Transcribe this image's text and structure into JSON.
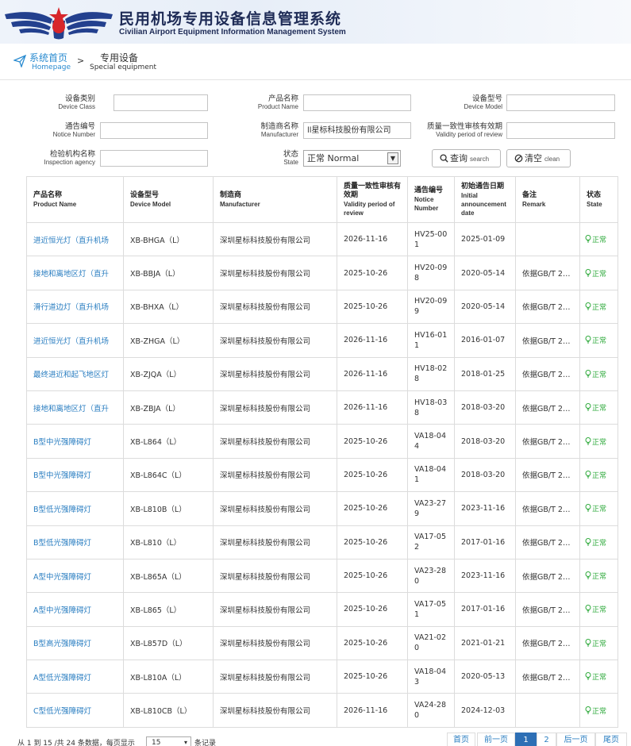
{
  "header": {
    "title_cn": "民用机场专用设备信息管理系统",
    "title_en": "Civilian Airport Equipment Information Management System"
  },
  "breadcrumb": {
    "home_cn": "系统首页",
    "home_en": "Homepage",
    "separator": ">",
    "current_cn": "专用设备",
    "current_en": "Special equipment"
  },
  "filters": {
    "device_class": {
      "label_cn": "设备类别",
      "label_en": "Device Class",
      "value": ""
    },
    "product_name": {
      "label_cn": "产品名称",
      "label_en": "Product Name",
      "value": ""
    },
    "device_model": {
      "label_cn": "设备型号",
      "label_en": "Device Model",
      "value": ""
    },
    "notice_number": {
      "label_cn": "通告编号",
      "label_en": "Notice Number",
      "value": ""
    },
    "manufacturer": {
      "label_cn": "制造商名称",
      "label_en": "Manufacturer",
      "value": "ll星标科技股份有限公司"
    },
    "validity": {
      "label_cn": "质量一致性审核有效期",
      "label_en": "Validity period of review",
      "value": ""
    },
    "inspection": {
      "label_cn": "检验机构名称",
      "label_en": "Inspection agency",
      "value": ""
    },
    "state": {
      "label_cn": "状态",
      "label_en": "State",
      "value": "正常 Normal"
    },
    "search_btn": {
      "cn": "查询",
      "en": "search"
    },
    "clean_btn": {
      "cn": "清空",
      "en": "clean"
    }
  },
  "table": {
    "headers": [
      {
        "cn": "产品名称",
        "en": "Product Name"
      },
      {
        "cn": "设备型号",
        "en": "Device Model"
      },
      {
        "cn": "制造商",
        "en": "Manufacturer"
      },
      {
        "cn": "质量一致性审核有效期",
        "en": "Validity period of review"
      },
      {
        "cn": "通告编号",
        "en": "Notice Number"
      },
      {
        "cn": "初始通告日期",
        "en": "Initial announcement date"
      },
      {
        "cn": "备注",
        "en": "Remark"
      },
      {
        "cn": "状态",
        "en": "State"
      }
    ],
    "rows": [
      {
        "name": "进近恒光灯（直升机场",
        "model": "XB-BHGA（L）",
        "maker": "深圳星标科技股份有限公司",
        "validity": "2026-11-16",
        "notice": "HV25-001",
        "date": "2025-01-09",
        "remark": "",
        "state": "正常"
      },
      {
        "name": "接地和离地区灯（直升",
        "model": "XB-BBJA（L）",
        "maker": "深圳星标科技股份有限公司",
        "validity": "2025-10-26",
        "notice": "HV20-098",
        "date": "2020-05-14",
        "remark": "依据GB/T 24...",
        "state": "正常"
      },
      {
        "name": "滑行道边灯（直升机场",
        "model": "XB-BHXA（L）",
        "maker": "深圳星标科技股份有限公司",
        "validity": "2025-10-26",
        "notice": "HV20-099",
        "date": "2020-05-14",
        "remark": "依据GB/T 24...",
        "state": "正常"
      },
      {
        "name": "进近恒光灯（直升机场",
        "model": "XB-ZHGA（L）",
        "maker": "深圳星标科技股份有限公司",
        "validity": "2026-11-16",
        "notice": "HV16-011",
        "date": "2016-01-07",
        "remark": "依据GB/T 24...",
        "state": "正常"
      },
      {
        "name": "最终进近和起飞地区灯",
        "model": "XB-ZJQA（L）",
        "maker": "深圳星标科技股份有限公司",
        "validity": "2026-11-16",
        "notice": "HV18-028",
        "date": "2018-01-25",
        "remark": "依据GB/T 24...",
        "state": "正常"
      },
      {
        "name": "接地和离地区灯（直升",
        "model": "XB-ZBJA（L）",
        "maker": "深圳星标科技股份有限公司",
        "validity": "2026-11-16",
        "notice": "HV18-038",
        "date": "2018-03-20",
        "remark": "依据GB/T 24...",
        "state": "正常"
      },
      {
        "name": "B型中光强障碍灯",
        "model": "XB-L864（L）",
        "maker": "深圳星标科技股份有限公司",
        "validity": "2025-10-26",
        "notice": "VA18-044",
        "date": "2018-03-20",
        "remark": "依据GB/T 24...",
        "state": "正常"
      },
      {
        "name": "B型中光强障碍灯",
        "model": "XB-L864C（L）",
        "maker": "深圳星标科技股份有限公司",
        "validity": "2025-10-26",
        "notice": "VA18-041",
        "date": "2018-03-20",
        "remark": "依据GB/T 24...",
        "state": "正常"
      },
      {
        "name": "B型低光强障碍灯",
        "model": "XB-L810B（L）",
        "maker": "深圳星标科技股份有限公司",
        "validity": "2025-10-26",
        "notice": "VA23-279",
        "date": "2023-11-16",
        "remark": "依据GB/T 24...",
        "state": "正常"
      },
      {
        "name": "B型低光强障碍灯",
        "model": "XB-L810（L）",
        "maker": "深圳星标科技股份有限公司",
        "validity": "2025-10-26",
        "notice": "VA17-052",
        "date": "2017-01-16",
        "remark": "依据GB/T 24...",
        "state": "正常"
      },
      {
        "name": "A型中光强障碍灯",
        "model": "XB-L865A（L）",
        "maker": "深圳星标科技股份有限公司",
        "validity": "2025-10-26",
        "notice": "VA23-280",
        "date": "2023-11-16",
        "remark": "依据GB/T 24...",
        "state": "正常"
      },
      {
        "name": "A型中光强障碍灯",
        "model": "XB-L865（L）",
        "maker": "深圳星标科技股份有限公司",
        "validity": "2025-10-26",
        "notice": "VA17-051",
        "date": "2017-01-16",
        "remark": "依据GB/T 24...",
        "state": "正常"
      },
      {
        "name": "B型高光强障碍灯",
        "model": "XB-L857D（L）",
        "maker": "深圳星标科技股份有限公司",
        "validity": "2025-10-26",
        "notice": "VA21-020",
        "date": "2021-01-21",
        "remark": "依据GB/T 24...",
        "state": "正常"
      },
      {
        "name": "A型低光强障碍灯",
        "model": "XB-L810A（L）",
        "maker": "深圳星标科技股份有限公司",
        "validity": "2025-10-26",
        "notice": "VA18-043",
        "date": "2020-05-13",
        "remark": "依据GB/T 24...",
        "state": "正常"
      },
      {
        "name": "C型低光强障碍灯",
        "model": "XB-L810CB（L）",
        "maker": "深圳星标科技股份有限公司",
        "validity": "2026-11-16",
        "notice": "VA24-280",
        "date": "2024-12-03",
        "remark": "",
        "state": "正常"
      }
    ]
  },
  "footer": {
    "info": "从 1 到 15 /共 24 条数据，每页显示",
    "page_size": "15",
    "unit": "条记录",
    "pages": [
      "首页",
      "前一页",
      "1",
      "2",
      "后一页",
      "尾页"
    ]
  },
  "colors": {
    "link": "#2a7ec1",
    "state_green": "#2faa3c",
    "active_page": "#2d6fb5",
    "title": "#1e2b56"
  }
}
